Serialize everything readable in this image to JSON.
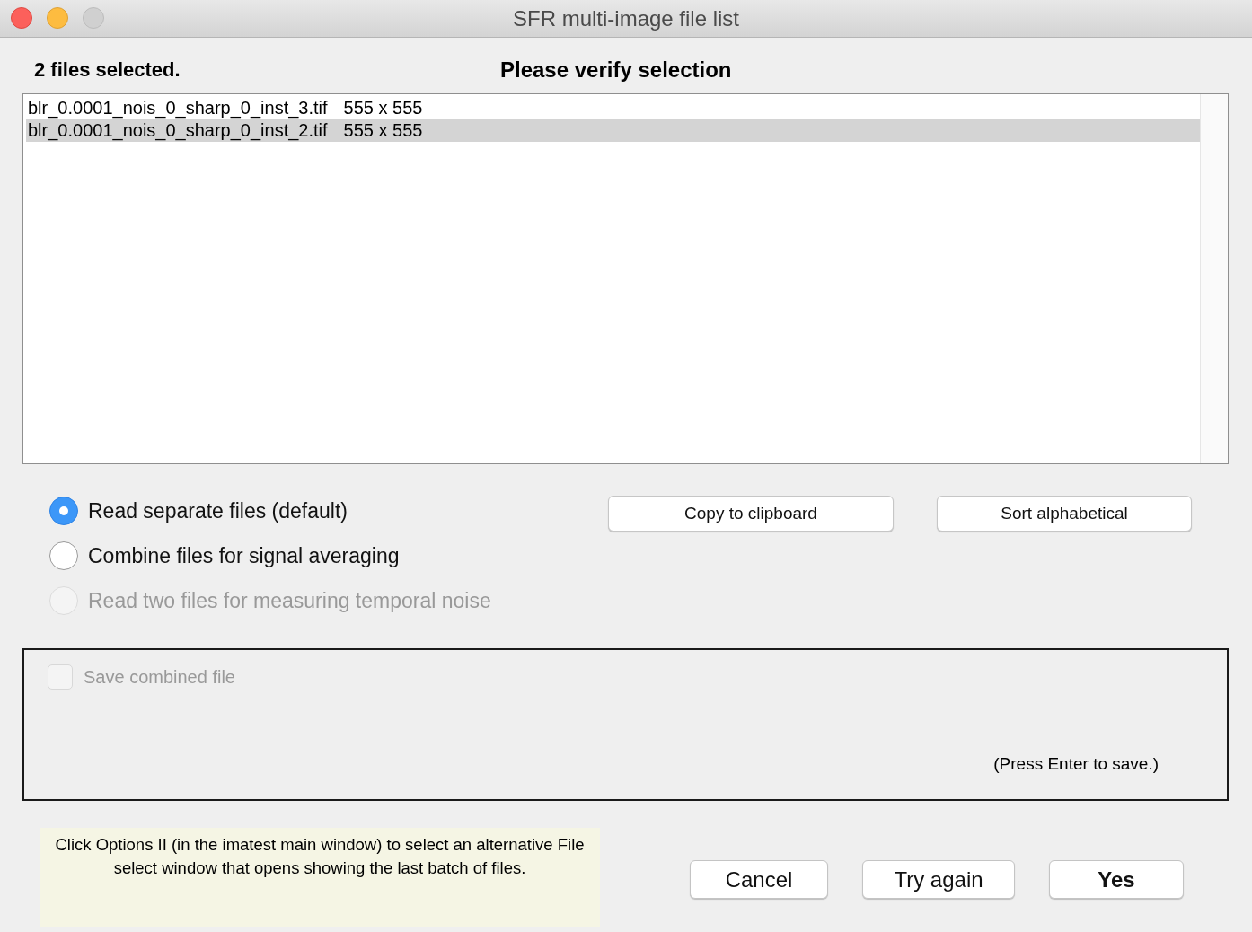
{
  "window": {
    "title": "SFR multi-image file list"
  },
  "header": {
    "count": "2 files selected.",
    "prompt": "Please verify selection"
  },
  "file_list": [
    {
      "name": "blr_0.0001_nois_0_sharp_0_inst_3.tif",
      "size": "555 x 555",
      "selected": false
    },
    {
      "name": "blr_0.0001_nois_0_sharp_0_inst_2.tif",
      "size": "555 x 555",
      "selected": true
    }
  ],
  "modes": [
    {
      "label": "Read separate files (default)",
      "selected": true,
      "disabled": false
    },
    {
      "label": "Combine files for signal averaging",
      "selected": false,
      "disabled": false
    },
    {
      "label": "Read two files for measuring temporal noise",
      "selected": false,
      "disabled": true
    }
  ],
  "list_buttons": [
    "Copy to clipboard",
    "Sort alphabetical"
  ],
  "save_group": {
    "checkbox": {
      "label": "Save combined file",
      "checked": false,
      "disabled": true
    },
    "hint": "(Press Enter to save.)"
  },
  "note": "Click Options II (in the imatest main window) to select an alternative File select window that opens showing the last batch of files.",
  "buttons": [
    {
      "label": "Cancel",
      "default": false
    },
    {
      "label": "Try again",
      "default": false
    },
    {
      "label": "Yes",
      "default": true
    }
  ]
}
